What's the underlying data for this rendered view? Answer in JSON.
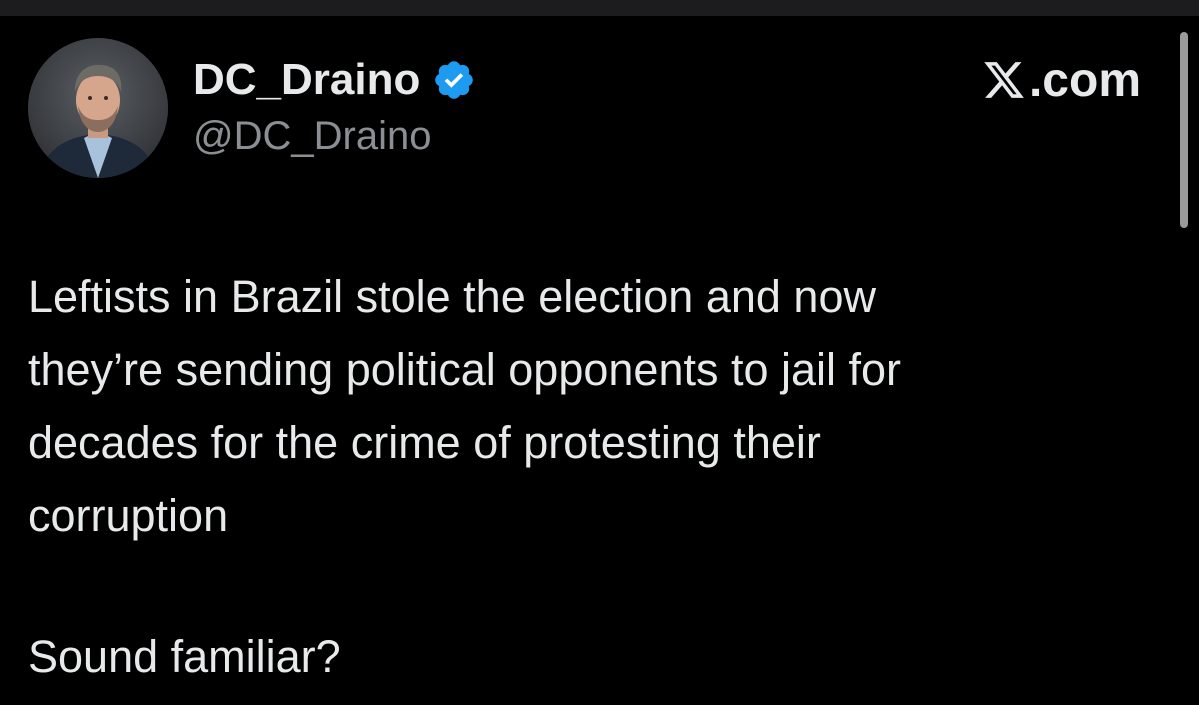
{
  "author": {
    "display_name": "DC_Draino",
    "handle": "@DC_Draino",
    "verified": true,
    "avatar_icon": "profile-photo"
  },
  "brand": {
    "text": ".com",
    "logo_icon": "x-logo-icon"
  },
  "post": {
    "lines": [
      "Leftists in Brazil stole the election and now",
      "they’re sending political opponents to jail for",
      "decades for the crime of protesting their",
      "corruption"
    ],
    "followup": "Sound familiar?"
  },
  "colors": {
    "background": "#000000",
    "text_primary": "#e7e9ea",
    "text_secondary": "#8b8f94",
    "verified_blue": "#1d9bf0"
  }
}
